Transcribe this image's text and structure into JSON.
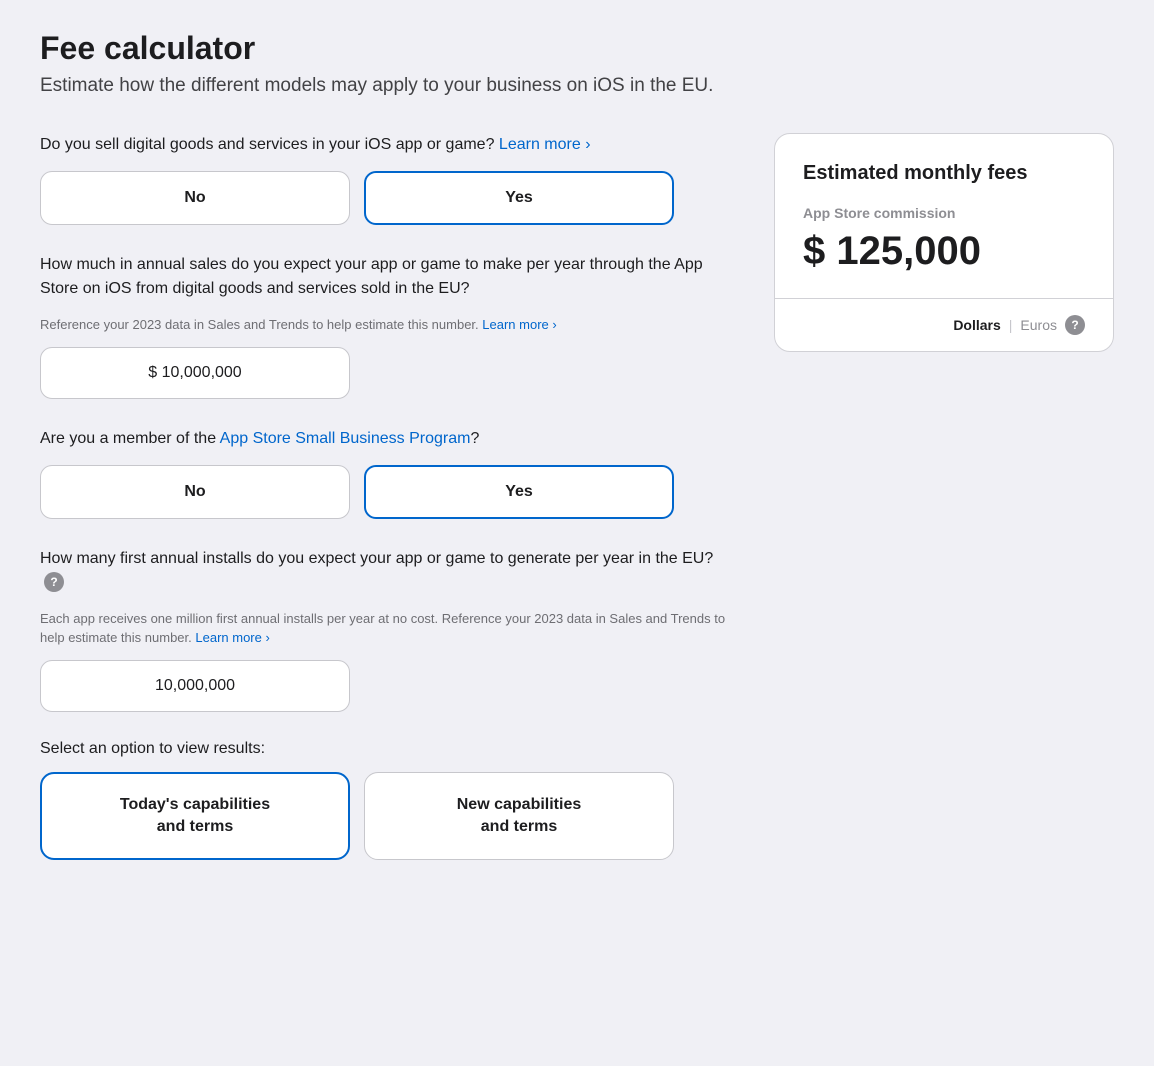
{
  "page": {
    "title": "Fee calculator",
    "subtitle": "Estimate how the different models may apply to your business on iOS in the EU."
  },
  "questions": {
    "q1": {
      "label": "Do you sell digital goods and services in your iOS app or game?",
      "learn_more": "Learn more ›",
      "no_label": "No",
      "yes_label": "Yes",
      "selected": "yes"
    },
    "q2": {
      "label_prefix": "How much in annual sales do you expect your app or game to make per year through the App Store on iOS from digital goods and services sold in the EU?",
      "sub_label": "Reference your 2023 data in Sales and Trends to help estimate this number.",
      "sub_learn_more": "Learn more ›",
      "value": "$ 10,000,000"
    },
    "q3": {
      "label_prefix": "Are you a member of the ",
      "link_text": "App Store Small Business Program",
      "label_suffix": "?",
      "no_label": "No",
      "yes_label": "Yes",
      "selected": "yes"
    },
    "q4": {
      "label": "How many first annual installs do you expect your app or game to generate per year in the EU?",
      "sub_label": "Each app receives one million first annual installs per year at no cost. Reference your 2023 data in Sales and Trends to help estimate this number.",
      "sub_learn_more": "Learn more ›",
      "value": "10,000,000",
      "has_help": true
    }
  },
  "select_option": {
    "label": "Select an option to view results:",
    "btn1_label": "Today's capabilities\nand terms",
    "btn2_label": "New capabilities\nand terms",
    "selected": "today"
  },
  "fees_card": {
    "title": "Estimated monthly fees",
    "commission_label": "App Store commission",
    "amount": "$ 125,000",
    "currency_dollars": "Dollars",
    "currency_euros": "Euros",
    "selected_currency": "dollars"
  }
}
